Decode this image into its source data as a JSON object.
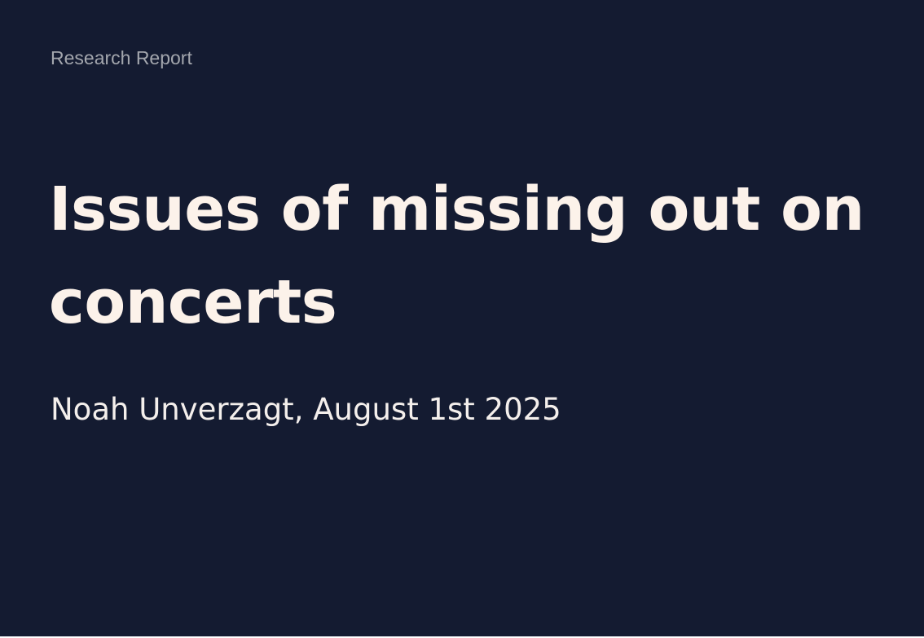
{
  "slide": {
    "kicker": "Research Report",
    "title": "Issues of missing out on concerts",
    "byline": "Noah Unverzagt, August 1st 2025"
  }
}
